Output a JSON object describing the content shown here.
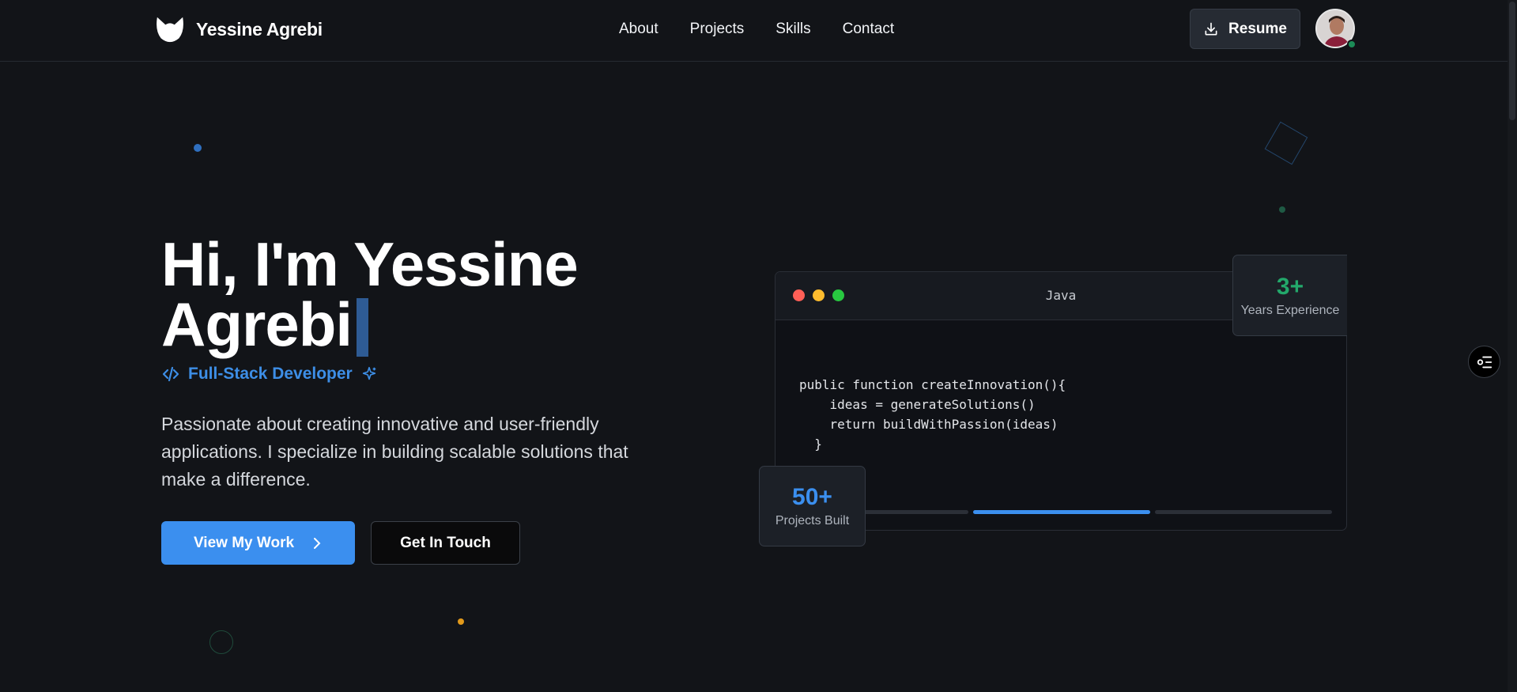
{
  "nav": {
    "brand": "Yessine Agrebi",
    "links": [
      "About",
      "Projects",
      "Skills",
      "Contact"
    ],
    "resume_label": "Resume"
  },
  "hero": {
    "title_line1": "Hi, I'm Yessine",
    "title_line2": "Agrebi",
    "role": "Full-Stack Developer",
    "description": "Passionate about creating innovative and user-friendly applications. I specialize in building scalable solutions that make a difference.",
    "primary_button": "View My Work",
    "secondary_button": "Get In Touch"
  },
  "code_window": {
    "language": "Java",
    "lines": [
      "public function createInnovation(){",
      "    ideas = generateSolutions()",
      "    return buildWithPassion(ideas)",
      "  }"
    ]
  },
  "stats": {
    "experience_value": "3+",
    "experience_label": "Years Experience",
    "projects_value": "50+",
    "projects_label": "Projects Built"
  },
  "colors": {
    "background": "#121418",
    "accent_blue": "#3b8fef",
    "accent_green": "#23a86b",
    "dot_red": "#ff5f57",
    "dot_yellow": "#febc2e",
    "dot_green": "#28c840"
  }
}
